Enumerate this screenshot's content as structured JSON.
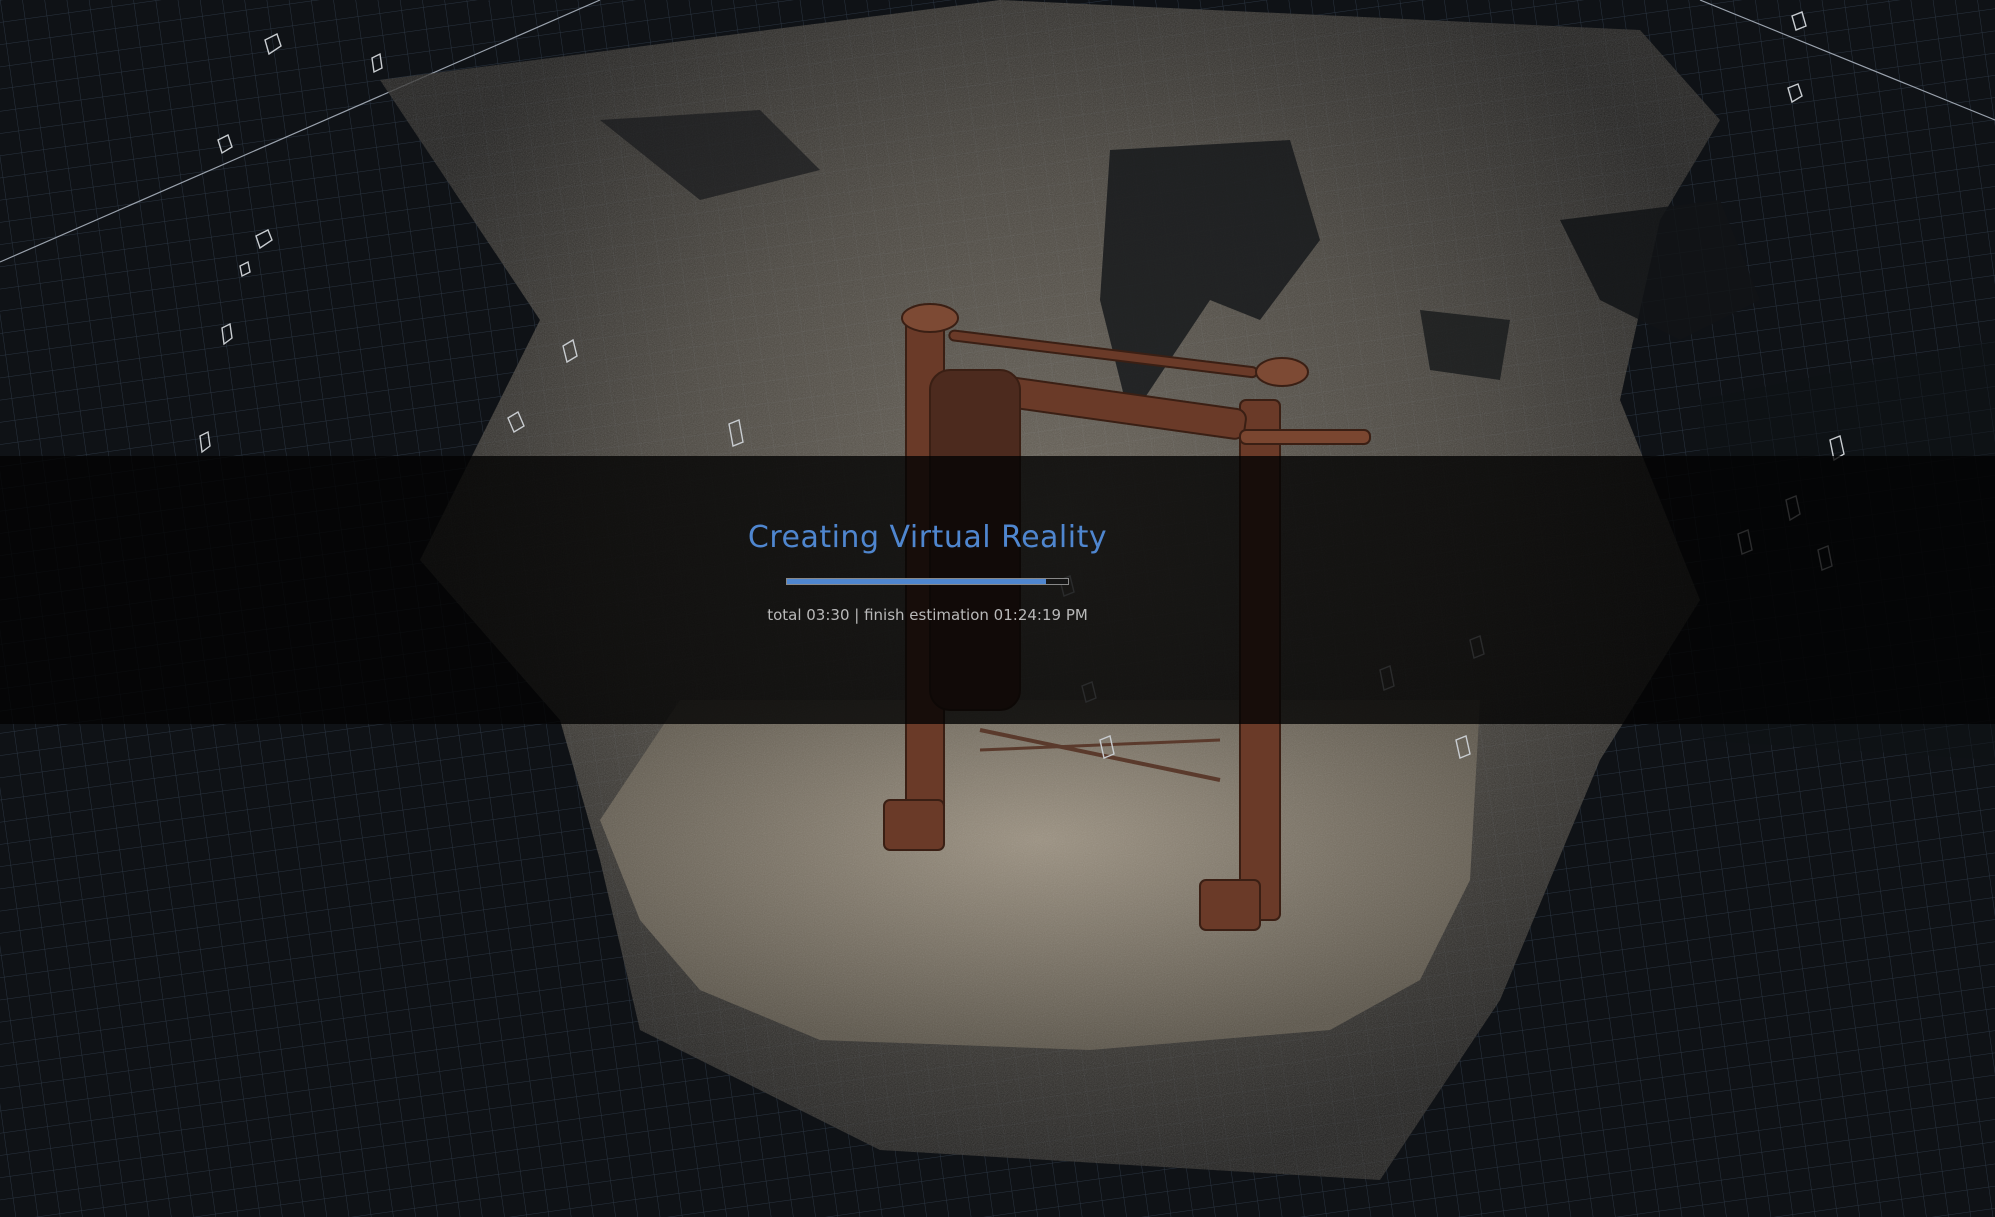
{
  "overlay": {
    "title": "Creating Virtual Reality",
    "progress": 0.92,
    "status": "total 03:30 | finish estimation 01:24:19 PM"
  },
  "colors": {
    "accent": "#4f86cf",
    "background": "#0f1216",
    "overlay": "#050505",
    "status_text": "#b9b9b9"
  }
}
